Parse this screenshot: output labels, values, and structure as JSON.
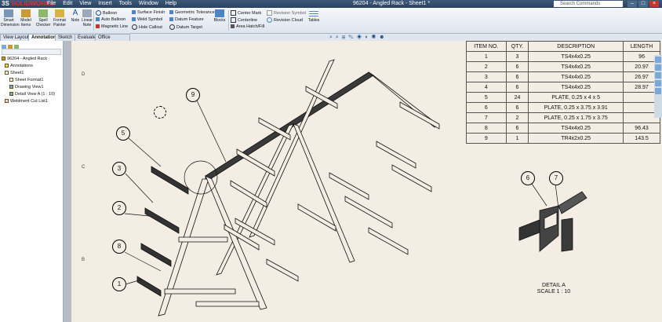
{
  "app": {
    "logo_prefix": "3S",
    "logo_text": "SOLIDWORKS",
    "menus": [
      "File",
      "Edit",
      "View",
      "Insert",
      "Tools",
      "Window",
      "Help"
    ],
    "doc_title": "96204 - Angled Rack - Sheet1 *",
    "search_placeholder": "Search Commands",
    "window_buttons": [
      "–",
      "□",
      "×"
    ]
  },
  "ribbon": {
    "big_buttons": [
      "Smart Dimension",
      "Model Items",
      "Spell Checker",
      "Format Painter",
      "Note",
      "Linear Note"
    ],
    "group1": [
      "Balloon",
      "Auto Balloon",
      "Magnetic Line"
    ],
    "group2": [
      "Surface Finish",
      "Weld Symbol",
      "Hole Callout"
    ],
    "group3": [
      "Geometric Tolerance",
      "Datum Feature",
      "Datum Target"
    ],
    "blocks_label": "Blocks",
    "group4": [
      "Center Mark",
      "Centerline",
      "Area Hatch/Fill"
    ],
    "group5": [
      "Revision Symbol",
      "Revision Cloud"
    ],
    "tables_label": "Tables"
  },
  "tabs": [
    "View Layout",
    "Annotation",
    "Sketch",
    "Evaluate",
    "Office Products"
  ],
  "active_tab": "Annotation",
  "tree": {
    "root": "96204 - Angled Rack",
    "items": [
      "Annotations",
      "Sheet1",
      "Sheet Format1",
      "Drawing View1",
      "Detail View A (1 : 10)",
      "Weldment Cut List1"
    ]
  },
  "zones": [
    "D",
    "C",
    "B"
  ],
  "bom": {
    "headers": [
      "ITEM NO.",
      "QTY.",
      "DESCRIPTION",
      "LENGTH"
    ],
    "rows": [
      [
        "1",
        "3",
        "TS4x4x0.25",
        "96"
      ],
      [
        "2",
        "6",
        "TS4x4x0.25",
        "20.97"
      ],
      [
        "3",
        "6",
        "TS4x4x0.25",
        "26.97"
      ],
      [
        "4",
        "6",
        "TS4x4x0.25",
        "28.97"
      ],
      [
        "5",
        "24",
        "PLATE, 0.25 x 4 x 5",
        ""
      ],
      [
        "6",
        "6",
        "PLATE, 0.25 x 3.75 x 3.91",
        ""
      ],
      [
        "7",
        "2",
        "PLATE, 0.25 x 1.75 x 3.75",
        ""
      ],
      [
        "8",
        "6",
        "TS4x4x0.25",
        "96.43"
      ],
      [
        "9",
        "1",
        "TR4x2x0.25",
        "143.5"
      ]
    ]
  },
  "balloons": [
    "1",
    "8",
    "2",
    "3",
    "5",
    "9"
  ],
  "detail_balloons": [
    "6",
    "7"
  ],
  "detail": {
    "title": "DETAIL A",
    "scale": "SCALE 1 : 10"
  },
  "colors": {
    "sheet": "#f4ede3",
    "titlebar": "#2a4260",
    "balloon": "#000000"
  }
}
